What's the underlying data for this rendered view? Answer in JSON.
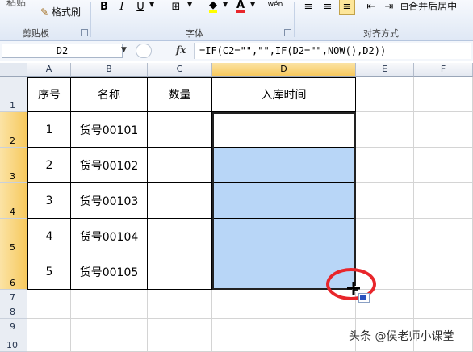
{
  "ribbon": {
    "paste_partial": "粘贴",
    "format_painter": "格式刷",
    "clipboard_title": "剪贴板",
    "font_title": "字体",
    "alignment_title": "对齐方式",
    "merge_center": "合并后居中",
    "bold": "B",
    "italic": "I",
    "underline": "U",
    "font_color_letter": "A",
    "wen": "wén"
  },
  "formula_bar": {
    "name_box": "D2",
    "fx": "fx",
    "formula": "=IF(C2=\"\",\"\",IF(D2=\"\",NOW(),D2))"
  },
  "columns": [
    "A",
    "B",
    "C",
    "D",
    "E",
    "F"
  ],
  "rows": [
    "1",
    "2",
    "3",
    "4",
    "5",
    "6",
    "7",
    "8",
    "9",
    "10"
  ],
  "table": {
    "headers": [
      "序号",
      "名称",
      "数量",
      "入库时间"
    ],
    "rows": [
      [
        "1",
        "货号00101",
        "",
        ""
      ],
      [
        "2",
        "货号00102",
        "",
        ""
      ],
      [
        "3",
        "货号00103",
        "",
        ""
      ],
      [
        "4",
        "货号00104",
        "",
        ""
      ],
      [
        "5",
        "货号00105",
        "",
        ""
      ]
    ]
  },
  "colors": {
    "selection_fill": "#b8d6f7",
    "highlight_ring": "#e8262b",
    "header_selected": "#f7c95e"
  },
  "watermark": "头条 @侯老师小课堂"
}
